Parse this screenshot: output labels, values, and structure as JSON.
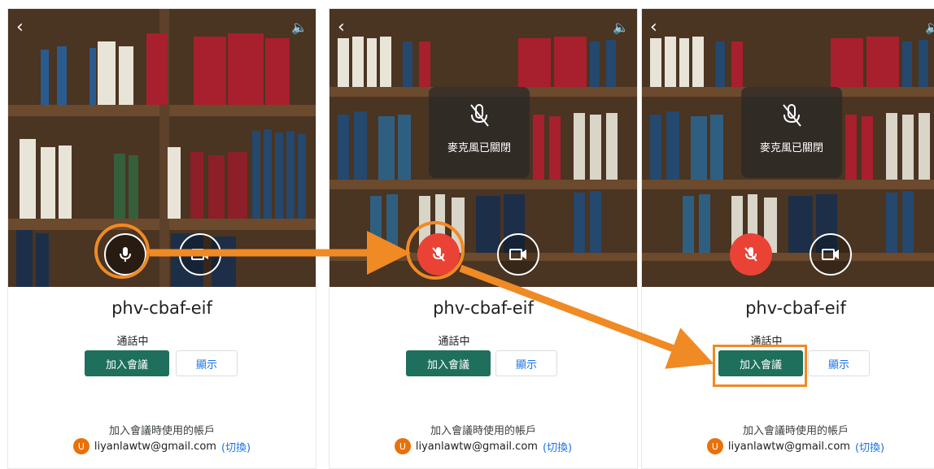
{
  "panels": [
    {
      "back_icon": "‹",
      "volume_icon": "🔈",
      "mic_state": "on",
      "meeting_code": "phv-cbaf-eif",
      "status": "通話中",
      "join_label": "加入會議",
      "show_label": "顯示",
      "account_label": "加入會議時使用的帳戶",
      "avatar_letter": "U",
      "email": "liyanlawtw@gmail.com",
      "switch_label": "(切換)"
    },
    {
      "back_icon": "‹",
      "volume_icon": "🔈",
      "mic_state": "off",
      "mute_toast": "麥克風已關閉",
      "meeting_code": "phv-cbaf-eif",
      "status": "通話中",
      "join_label": "加入會議",
      "show_label": "顯示",
      "account_label": "加入會議時使用的帳戶",
      "avatar_letter": "U",
      "email": "liyanlawtw@gmail.com",
      "switch_label": "(切換)"
    },
    {
      "back_icon": "‹",
      "volume_icon": "🔈",
      "mic_state": "off",
      "mute_toast": "麥克風已關閉",
      "meeting_code": "phv-cbaf-eif",
      "status": "通話中",
      "join_label": "加入會議",
      "show_label": "顯示",
      "account_label": "加入會議時使用的帳戶",
      "avatar_letter": "U",
      "email": "liyanlawtw@gmail.com",
      "switch_label": "(切換)"
    }
  ],
  "colors": {
    "highlight": "#f08a24",
    "join_button": "#1e6f5c",
    "mic_off": "#ea4335",
    "link": "#1a73e8"
  }
}
